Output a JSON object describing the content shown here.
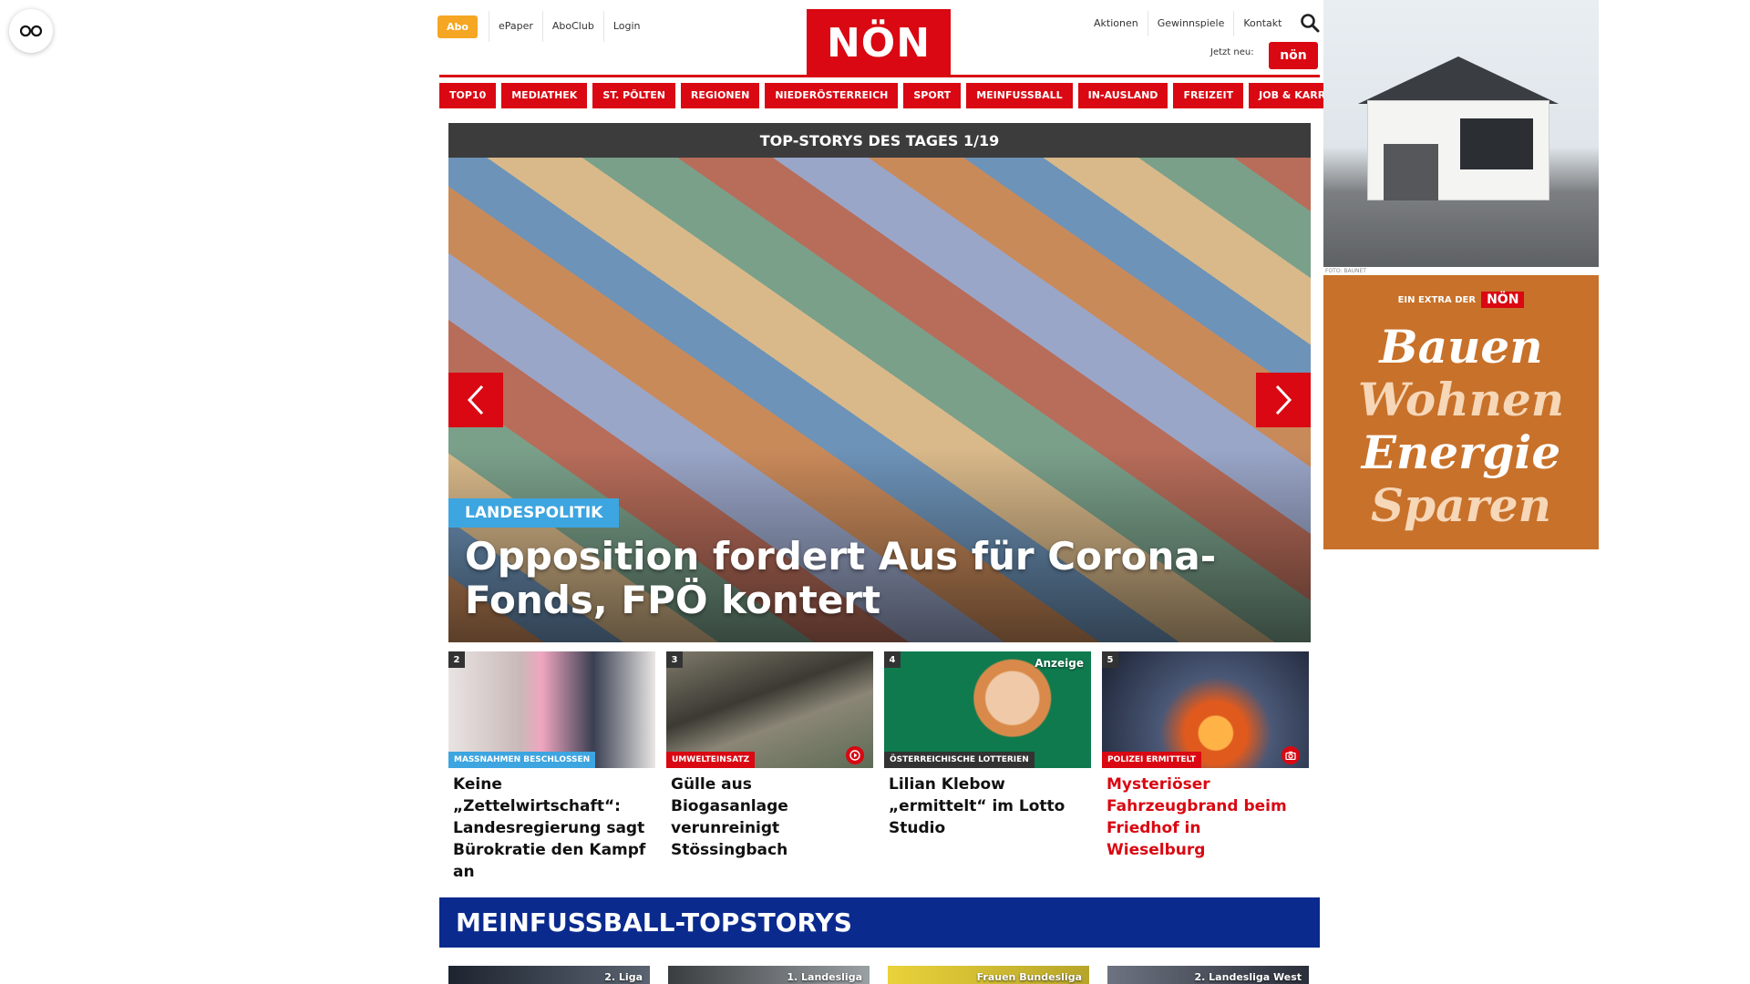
{
  "accessibility": {
    "icon": "glasses-icon"
  },
  "header": {
    "abo": "Abo",
    "left_links": [
      "ePaper",
      "AboClub",
      "Login"
    ],
    "logo": "NÖN",
    "right_links": [
      "Aktionen",
      "Gewinnspiele",
      "Kontakt"
    ],
    "search_icon": "search-icon",
    "jetzt_label": "Jetzt neu:",
    "jetzt_badge": "nön"
  },
  "nav": [
    "TOP10",
    "MEDIATHEK",
    "ST. PÖLTEN",
    "REGIONEN",
    "NIEDERÖSTERREICH",
    "SPORT",
    "MEINFUSSBALL",
    "IN-AUSLAND",
    "FREIZEIT",
    "JOB & KARRIERE"
  ],
  "slider": {
    "heading": "TOP-STORYS DES TAGES 1/19",
    "kicker": "LANDESPOLITIK",
    "title": "Opposition fordert Aus für Corona-Fonds, FPÖ kontert",
    "prev_icon": "chevron-left-icon",
    "next_icon": "chevron-right-icon"
  },
  "cards": [
    {
      "num": "2",
      "tag": "MASSNAHMEN BESCHLOSSEN",
      "tag_color": "#3da5e0",
      "title": "Keine „Zettelwirtschaft“: Landesregierung sagt Bürokratie den Kampf an",
      "red": false,
      "anzeige": "",
      "media": ""
    },
    {
      "num": "3",
      "tag": "UMWELTEINSATZ",
      "tag_color": "#d90812",
      "title": "Gülle aus Biogasanlage verunreinigt Stössingbach",
      "red": false,
      "anzeige": "",
      "media": "video-icon"
    },
    {
      "num": "4",
      "tag": "ÖSTERREICHISCHE LOTTERIEN",
      "tag_color": "#333333",
      "title": "Lilian Klebow „ermittelt“ im Lotto Studio",
      "red": false,
      "anzeige": "Anzeige",
      "media": ""
    },
    {
      "num": "5",
      "tag": "POLIZEI ERMITTELT",
      "tag_color": "#d90812",
      "title": "Mysteriöser Fahrzeugbrand beim Friedhof in Wieselburg",
      "red": true,
      "anzeige": "",
      "media": "camera-icon"
    }
  ],
  "meinfussball": {
    "heading": "MEINFUSSBALL-TOPSTORYS",
    "cards": [
      "2. Liga",
      "1. Landesliga",
      "Frauen Bundesliga",
      "2. Landesliga West"
    ]
  },
  "ads": {
    "credit": "FOTO: BAUNET",
    "extra_label": "EIN EXTRA DER",
    "extra_logo": "NÖN",
    "words": [
      "Bauen",
      "Wohnen",
      "Energie",
      "Sparen"
    ],
    "word_colors": [
      "#ffffff",
      "#f6d7b8",
      "#ffffff",
      "#f6d7b8"
    ]
  },
  "colors": {
    "brand_red": "#d90812",
    "navy": "#0a2a8e",
    "accent_blue": "#3da5e0"
  }
}
